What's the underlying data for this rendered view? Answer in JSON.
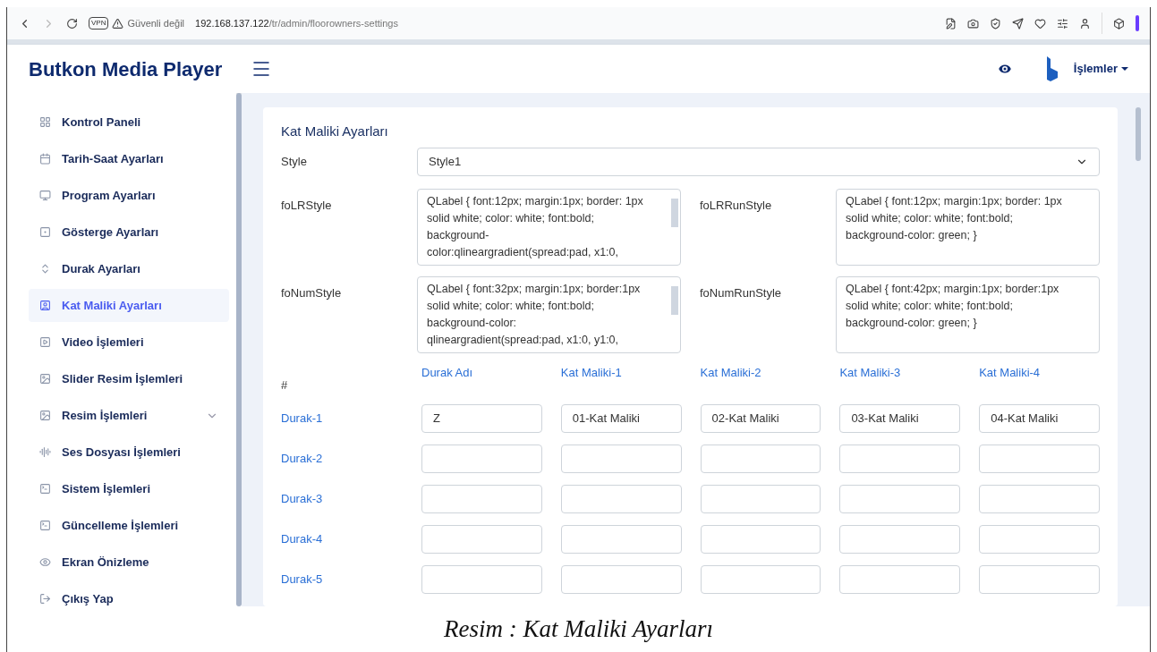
{
  "browser": {
    "vpn": "VPN",
    "security": "Güvenli değil",
    "url_host": "192.168.137.122",
    "url_path": "/tr/admin/floorowners-settings"
  },
  "header": {
    "title": "Butkon Media Player",
    "user_menu": "İşlemler"
  },
  "sidebar": {
    "items": [
      {
        "label": "Kontrol Paneli",
        "selected": false
      },
      {
        "label": "Tarih-Saat Ayarları",
        "selected": false
      },
      {
        "label": "Program Ayarları",
        "selected": false
      },
      {
        "label": "Gösterge Ayarları",
        "selected": false
      },
      {
        "label": "Durak Ayarları",
        "selected": false
      },
      {
        "label": "Kat Maliki Ayarları",
        "selected": true
      },
      {
        "label": "Video İşlemleri",
        "selected": false
      },
      {
        "label": "Slider Resim İşlemleri",
        "selected": false
      },
      {
        "label": "Resim İşlemleri",
        "selected": false,
        "expanded": false
      },
      {
        "label": "Ses Dosyası İşlemleri",
        "selected": false
      },
      {
        "label": "Sistem İşlemleri",
        "selected": false
      },
      {
        "label": "Güncelleme İşlemleri",
        "selected": false
      },
      {
        "label": "Ekran Önizleme",
        "selected": false
      },
      {
        "label": "Çıkış Yap",
        "selected": false
      }
    ]
  },
  "form": {
    "title": "Kat Maliki Ayarları",
    "style": {
      "label": "Style",
      "value": "Style1"
    },
    "style_rows": [
      [
        {
          "label": "foLRStyle",
          "value": "QLabel { font:12px; margin:1px; border: 1px solid white; color: white; font:bold; background-color:qlineargradient(spread:pad, x1:0,",
          "scrollbar": true
        },
        {
          "label": "foLRRunStyle",
          "value": "QLabel { font:12px; margin:1px; border: 1px solid white; color: white; font:bold; background-color: green; }",
          "scrollbar": false
        }
      ],
      [
        {
          "label": "foNumStyle",
          "value": "QLabel { font:32px; margin:1px; border:1px solid white; color: white; font:bold; background-color: qlineargradient(spread:pad, x1:0, y1:0,",
          "scrollbar": true
        },
        {
          "label": "foNumRunStyle",
          "value": "QLabel { font:42px; margin:1px; border:1px solid white; color: white; font:bold; background-color: green; }",
          "scrollbar": false
        }
      ]
    ],
    "grid": {
      "columns": [
        "#",
        "Durak Adı",
        "Kat Maliki-1",
        "Kat Maliki-2",
        "Kat Maliki-3",
        "Kat Maliki-4"
      ],
      "rows": [
        {
          "label": "Durak-1",
          "values": [
            "Z",
            "01-Kat Maliki",
            "02-Kat Maliki",
            "03-Kat Maliki",
            "04-Kat Maliki"
          ]
        },
        {
          "label": "Durak-2"
        },
        {
          "label": "Durak-3"
        },
        {
          "label": "Durak-4"
        },
        {
          "label": "Durak-5"
        }
      ]
    }
  },
  "caption": "Resim : Kat Maliki Ayarları"
}
